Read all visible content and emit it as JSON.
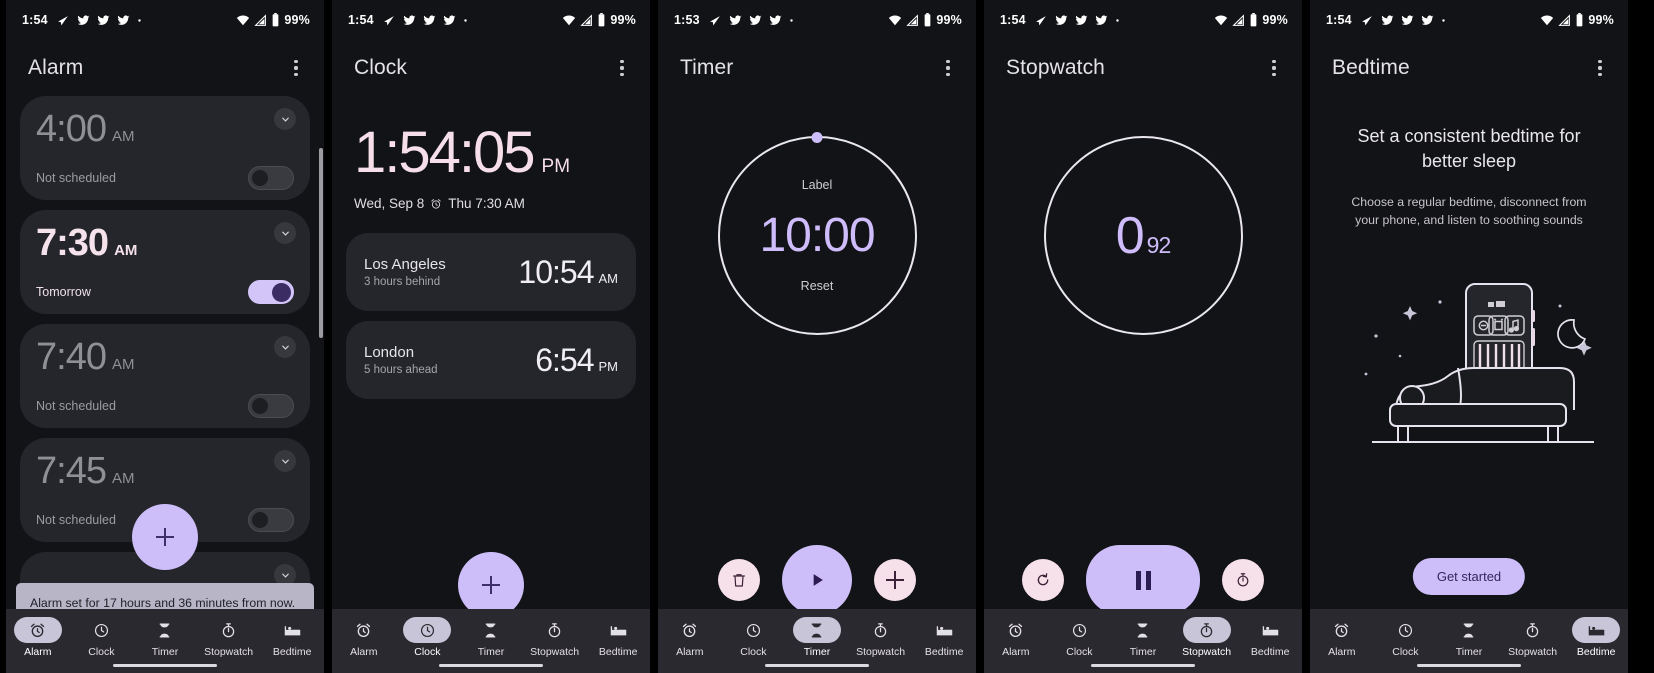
{
  "panels": [
    {
      "id": "alarm",
      "statusbar": {
        "time": "1:54",
        "battery": "99%",
        "icons": [
          "send-icon",
          "bird-icon",
          "bird-icon",
          "bird-icon",
          "dot-icon"
        ]
      },
      "title": "Alarm",
      "alarms": [
        {
          "time": "4:00",
          "ampm": "AM",
          "sub": "Not scheduled",
          "enabled": false
        },
        {
          "time": "7:30",
          "ampm": "AM",
          "sub": "Tomorrow",
          "enabled": true
        },
        {
          "time": "7:40",
          "ampm": "AM",
          "sub": "Not scheduled",
          "enabled": false
        },
        {
          "time": "7:45",
          "ampm": "AM",
          "sub": "Not scheduled",
          "enabled": false
        }
      ],
      "snackbar": "Alarm set for 17 hours and 36 minutes from now.",
      "fab_label": "+",
      "selected_tab": "Alarm"
    },
    {
      "id": "clock",
      "statusbar": {
        "time": "1:54",
        "battery": "99%"
      },
      "title": "Clock",
      "big_time": "1:54:05",
      "big_ampm": "PM",
      "date_line": "Wed, Sep 8",
      "next_alarm": "Thu 7:30 AM",
      "world_clocks": [
        {
          "city": "Los Angeles",
          "offset": "3 hours behind",
          "time": "10:54",
          "ampm": "AM"
        },
        {
          "city": "London",
          "offset": "5 hours ahead",
          "time": "6:54",
          "ampm": "PM"
        }
      ],
      "fab_label": "+",
      "selected_tab": "Clock"
    },
    {
      "id": "timer",
      "statusbar": {
        "time": "1:53",
        "battery": "99%"
      },
      "title": "Timer",
      "dial_label": "Label",
      "dial_time": "10:00",
      "dial_reset": "Reset",
      "buttons": [
        "delete-icon",
        "play-icon",
        "add-minute-icon"
      ],
      "selected_tab": "Timer"
    },
    {
      "id": "stopwatch",
      "statusbar": {
        "time": "1:54",
        "battery": "99%"
      },
      "title": "Stopwatch",
      "sw_seconds": "0",
      "sw_fraction": "92",
      "buttons": [
        "reset-icon",
        "pause-icon",
        "lap-icon"
      ],
      "selected_tab": "Stopwatch"
    },
    {
      "id": "bedtime",
      "statusbar": {
        "time": "1:54",
        "battery": "99%"
      },
      "title": "Bedtime",
      "headline": "Set a consistent bedtime for better sleep",
      "subtext": "Choose a regular bedtime, disconnect from your phone, and listen to soothing sounds",
      "cta": "Get started",
      "selected_tab": "Bedtime"
    }
  ],
  "nav": {
    "items": [
      {
        "label": "Alarm",
        "icon": "alarm-clock-icon"
      },
      {
        "label": "Clock",
        "icon": "clock-icon"
      },
      {
        "label": "Timer",
        "icon": "hourglass-icon"
      },
      {
        "label": "Stopwatch",
        "icon": "stopwatch-icon"
      },
      {
        "label": "Bedtime",
        "icon": "bed-icon"
      }
    ]
  },
  "colors": {
    "accent_purple": "#cdbdf8",
    "accent_pink": "#f6e0e9",
    "surface": "#25262b",
    "background": "#121316",
    "nav_surface": "#2b2930"
  }
}
